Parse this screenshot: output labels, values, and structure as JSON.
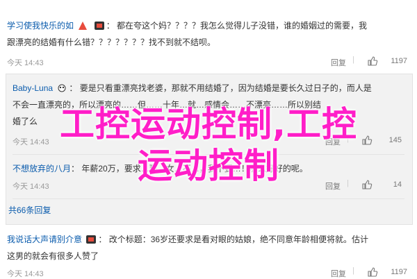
{
  "comments": [
    {
      "user": "学习使我快乐的如",
      "text1": "都在夸这个妈？？？？我怎么觉得儿子没错，谁的婚姻过的需要，我",
      "text2": "跟漂亮的结婚有什么错？？？？？？？找不到就不结呗。",
      "time": "今天 14:43",
      "reply": "回复",
      "likes": "1197"
    },
    {
      "user": "Baby-Luna",
      "text1": "要是只看重漂亮找老婆，那就不用结婚了，因为结婚是要长久过日子的，而人是",
      "text2": "不会一直漂亮的，所以漂亮的……但……十年…就…感情会……不漂亮……所以别结",
      "text3": "婚了么",
      "time": "今天 14:43",
      "reply": "回复",
      "likes": "145"
    },
    {
      "user": "不想放弃的八月",
      "text1": "年薪20万，要求…那…女…不…，我不要…！哪么好好的呢。",
      "time": "今天 14:43",
      "reply": "回复",
      "likes": "14"
    },
    {
      "user": "我说话大声请别介意",
      "text1": "改个标题：36岁还要求是看对眼的姑娘，绝不同意年龄相便将就。估计",
      "text2": "这男的就会有很多人赞了",
      "time": "今天 14:43",
      "reply": "回复",
      "likes": "1197"
    }
  ],
  "more_replies": "共66条回复",
  "overlay": {
    "line1": "工控运动控制,工控",
    "line2": "运动控制"
  },
  "colors": {
    "link": "#0b5cad",
    "overlay": "#ff1ec8",
    "subbox": "#f2f2f2"
  }
}
